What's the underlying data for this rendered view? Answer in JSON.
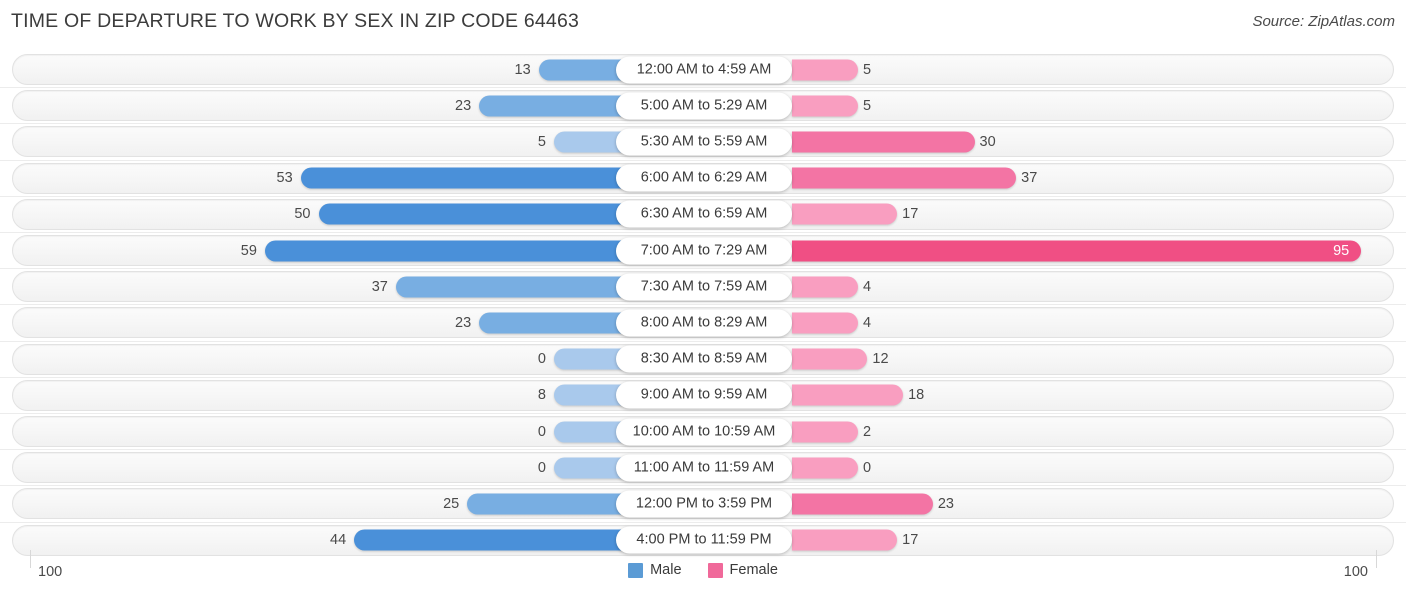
{
  "header": {
    "title": "TIME OF DEPARTURE TO WORK BY SEX IN ZIP CODE 64463",
    "source": "Source: ZipAtlas.com"
  },
  "legend": {
    "items": [
      {
        "label": "Male",
        "color": "#5b9bd5"
      },
      {
        "label": "Female",
        "color": "#f0699a"
      }
    ]
  },
  "axis": {
    "left_label": "100",
    "right_label": "100"
  },
  "colors": {
    "male_dark": "#4a90d9",
    "male_mid": "#78aee2",
    "male_light": "#a9c9ec",
    "female_dark": "#f04f84",
    "female_mid": "#f374a4",
    "female_light": "#f99ec0"
  },
  "chart_data": {
    "type": "bar",
    "orientation": "horizontal",
    "style": "diverging-bidirectional",
    "title": "TIME OF DEPARTURE TO WORK BY SEX IN ZIP CODE 64463",
    "xlabel": "",
    "ylabel": "",
    "xlim": [
      100,
      100
    ],
    "grid": false,
    "legend_position": "bottom-center",
    "categories": [
      "12:00 AM to 4:59 AM",
      "5:00 AM to 5:29 AM",
      "5:30 AM to 5:59 AM",
      "6:00 AM to 6:29 AM",
      "6:30 AM to 6:59 AM",
      "7:00 AM to 7:29 AM",
      "7:30 AM to 7:59 AM",
      "8:00 AM to 8:29 AM",
      "8:30 AM to 8:59 AM",
      "9:00 AM to 9:59 AM",
      "10:00 AM to 10:59 AM",
      "11:00 AM to 11:59 AM",
      "12:00 PM to 3:59 PM",
      "4:00 PM to 11:59 PM"
    ],
    "series": [
      {
        "name": "Male",
        "values": [
          13,
          23,
          5,
          53,
          50,
          59,
          37,
          23,
          0,
          8,
          0,
          0,
          25,
          44
        ]
      },
      {
        "name": "Female",
        "values": [
          5,
          5,
          30,
          37,
          17,
          95,
          4,
          4,
          12,
          18,
          2,
          0,
          23,
          17
        ]
      }
    ]
  },
  "rows": [
    {
      "label": "12:00 AM to 4:59 AM",
      "male": "13",
      "female": "5",
      "male_v": 13,
      "female_v": 5
    },
    {
      "label": "5:00 AM to 5:29 AM",
      "male": "23",
      "female": "5",
      "male_v": 23,
      "female_v": 5
    },
    {
      "label": "5:30 AM to 5:59 AM",
      "male": "5",
      "female": "30",
      "male_v": 5,
      "female_v": 30
    },
    {
      "label": "6:00 AM to 6:29 AM",
      "male": "53",
      "female": "37",
      "male_v": 53,
      "female_v": 37
    },
    {
      "label": "6:30 AM to 6:59 AM",
      "male": "50",
      "female": "17",
      "male_v": 50,
      "female_v": 17
    },
    {
      "label": "7:00 AM to 7:29 AM",
      "male": "59",
      "female": "95",
      "male_v": 59,
      "female_v": 95
    },
    {
      "label": "7:30 AM to 7:59 AM",
      "male": "37",
      "female": "4",
      "male_v": 37,
      "female_v": 4
    },
    {
      "label": "8:00 AM to 8:29 AM",
      "male": "23",
      "female": "4",
      "male_v": 23,
      "female_v": 4
    },
    {
      "label": "8:30 AM to 8:59 AM",
      "male": "0",
      "female": "12",
      "male_v": 0,
      "female_v": 12
    },
    {
      "label": "9:00 AM to 9:59 AM",
      "male": "8",
      "female": "18",
      "male_v": 8,
      "female_v": 18
    },
    {
      "label": "10:00 AM to 10:59 AM",
      "male": "0",
      "female": "2",
      "male_v": 0,
      "female_v": 2
    },
    {
      "label": "11:00 AM to 11:59 AM",
      "male": "0",
      "female": "0",
      "male_v": 0,
      "female_v": 0
    },
    {
      "label": "12:00 PM to 3:59 PM",
      "male": "25",
      "female": "23",
      "male_v": 25,
      "female_v": 23
    },
    {
      "label": "4:00 PM to 11:59 PM",
      "male": "44",
      "female": "17",
      "male_v": 44,
      "female_v": 17
    }
  ]
}
